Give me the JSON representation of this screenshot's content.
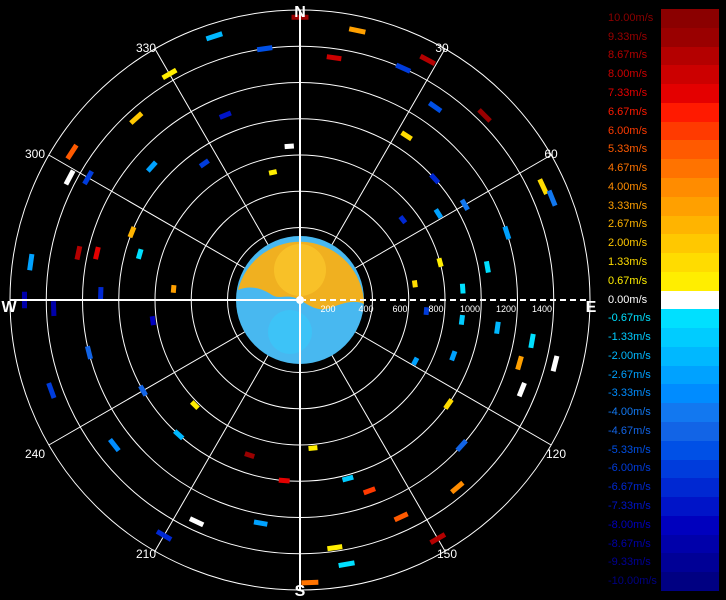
{
  "chart_data": {
    "type": "polar-ppi",
    "directions": {
      "north": "N",
      "east": "E",
      "south": "S",
      "west": "W"
    },
    "azimuth_labels": [
      "30",
      "60",
      "120",
      "150",
      "210",
      "240",
      "300",
      "330"
    ],
    "range_labels": [
      "200",
      "400",
      "600",
      "800",
      "1000",
      "1200",
      "1400"
    ],
    "legend": {
      "levels": [
        {
          "label": "10.00m/s",
          "color": "#8b0000"
        },
        {
          "label": "9.33m/s",
          "color": "#9a0000"
        },
        {
          "label": "8.67m/s",
          "color": "#b40000"
        },
        {
          "label": "8.00m/s",
          "color": "#cc0000"
        },
        {
          "label": "7.33m/s",
          "color": "#e40000"
        },
        {
          "label": "6.67m/s",
          "color": "#ff1a00"
        },
        {
          "label": "6.00m/s",
          "color": "#ff3a00"
        },
        {
          "label": "5.33m/s",
          "color": "#ff5a00"
        },
        {
          "label": "4.67m/s",
          "color": "#ff7300"
        },
        {
          "label": "4.00m/s",
          "color": "#ff8c00"
        },
        {
          "label": "3.33m/s",
          "color": "#ffa000"
        },
        {
          "label": "2.67m/s",
          "color": "#ffb400"
        },
        {
          "label": "2.00m/s",
          "color": "#ffc800"
        },
        {
          "label": "1.33m/s",
          "color": "#ffdc00"
        },
        {
          "label": "0.67m/s",
          "color": "#ffee00"
        },
        {
          "label": "0.00m/s",
          "color": "#ffffff"
        },
        {
          "label": "-0.67m/s",
          "color": "#00e0ff"
        },
        {
          "label": "-1.33m/s",
          "color": "#00ccff"
        },
        {
          "label": "-2.00m/s",
          "color": "#00b8ff"
        },
        {
          "label": "-2.67m/s",
          "color": "#00a2ff"
        },
        {
          "label": "-3.33m/s",
          "color": "#008cff"
        },
        {
          "label": "-4.00m/s",
          "color": "#1278f0"
        },
        {
          "label": "-4.67m/s",
          "color": "#1264e6"
        },
        {
          "label": "-5.33m/s",
          "color": "#0050e6"
        },
        {
          "label": "-6.00m/s",
          "color": "#003cdc"
        },
        {
          "label": "-6.67m/s",
          "color": "#0028d2"
        },
        {
          "label": "-7.33m/s",
          "color": "#0014c8"
        },
        {
          "label": "-8.00m/s",
          "color": "#0000be"
        },
        {
          "label": "-8.67m/s",
          "color": "#0000aa"
        },
        {
          "label": "-9.33m/s",
          "color": "#000096"
        },
        {
          "label": "-10.00m/s",
          "color": "#000082"
        }
      ]
    },
    "range_max": 1600,
    "ring_step": 200,
    "spoke_step_deg": 30,
    "grid": true,
    "legend_position": "right",
    "samples": [
      {
        "az": 0,
        "range": 1560,
        "v": 9.5
      },
      {
        "az": 12,
        "range": 1520,
        "v": 3.0
      },
      {
        "az": 8,
        "range": 1350,
        "v": 8.0
      },
      {
        "az": 28,
        "range": 1500,
        "v": 8.5
      },
      {
        "az": 24,
        "range": 1400,
        "v": -6.0
      },
      {
        "az": 35,
        "range": 1300,
        "v": -5.5
      },
      {
        "az": 33,
        "range": 1080,
        "v": 1.3
      },
      {
        "az": 45,
        "range": 1440,
        "v": 9.0
      },
      {
        "az": 48,
        "range": 1000,
        "v": -7.0
      },
      {
        "az": 58,
        "range": 900,
        "v": -3.0
      },
      {
        "az": 60,
        "range": 1050,
        "v": -4.0
      },
      {
        "az": 52,
        "range": 720,
        "v": -6.5
      },
      {
        "az": 65,
        "range": 1480,
        "v": 1.3
      },
      {
        "az": 68,
        "range": 1500,
        "v": -4.0
      },
      {
        "az": 72,
        "range": 1200,
        "v": -2.5
      },
      {
        "az": 75,
        "range": 800,
        "v": 0.6
      },
      {
        "az": 80,
        "range": 1050,
        "v": -1.0
      },
      {
        "az": 82,
        "range": 640,
        "v": 1.3
      },
      {
        "az": 86,
        "range": 900,
        "v": -0.7
      },
      {
        "az": 95,
        "range": 700,
        "v": -6.0
      },
      {
        "az": 97,
        "range": 900,
        "v": -1.3
      },
      {
        "az": 98,
        "range": 1100,
        "v": -2.0
      },
      {
        "az": 100,
        "range": 1300,
        "v": -0.7
      },
      {
        "az": 104,
        "range": 1450,
        "v": 0.0
      },
      {
        "az": 106,
        "range": 1260,
        "v": 3.3
      },
      {
        "az": 110,
        "range": 900,
        "v": -2.5
      },
      {
        "az": 112,
        "range": 1320,
        "v": 0.0
      },
      {
        "az": 118,
        "range": 720,
        "v": -3.0
      },
      {
        "az": 125,
        "range": 1000,
        "v": 1.3
      },
      {
        "az": 132,
        "range": 1200,
        "v": -4.5
      },
      {
        "az": 140,
        "range": 1350,
        "v": 4.0
      },
      {
        "az": 150,
        "range": 1520,
        "v": 8.5
      },
      {
        "az": 155,
        "range": 1320,
        "v": 5.0
      },
      {
        "az": 160,
        "range": 1120,
        "v": 6.0
      },
      {
        "az": 165,
        "range": 1020,
        "v": -1.3
      },
      {
        "az": 170,
        "range": 1480,
        "v": -0.7
      },
      {
        "az": 172,
        "range": 1380,
        "v": 1.0
      },
      {
        "az": 175,
        "range": 820,
        "v": 0.5
      },
      {
        "az": 178,
        "range": 1560,
        "v": 4.5
      },
      {
        "az": 185,
        "range": 1000,
        "v": 7.5
      },
      {
        "az": 190,
        "range": 1250,
        "v": -3.0
      },
      {
        "az": 198,
        "range": 900,
        "v": 9.0
      },
      {
        "az": 205,
        "range": 1350,
        "v": 0.0
      },
      {
        "az": 210,
        "range": 1500,
        "v": -7.0
      },
      {
        "az": 222,
        "range": 1000,
        "v": -2.0
      },
      {
        "az": 225,
        "range": 820,
        "v": 0.5
      },
      {
        "az": 232,
        "range": 1300,
        "v": -3.5
      },
      {
        "az": 240,
        "range": 1000,
        "v": -5.0
      },
      {
        "az": 250,
        "range": 1460,
        "v": -6.0
      },
      {
        "az": 256,
        "range": 1200,
        "v": -4.5
      },
      {
        "az": 262,
        "range": 820,
        "v": -8.0
      },
      {
        "az": 268,
        "range": 1360,
        "v": -8.5
      },
      {
        "az": 270,
        "range": 1520,
        "v": -9.0
      },
      {
        "az": 272,
        "range": 1100,
        "v": -6.5
      },
      {
        "az": 275,
        "range": 700,
        "v": 3.0
      },
      {
        "az": 278,
        "range": 1500,
        "v": -2.5
      },
      {
        "az": 282,
        "range": 1250,
        "v": 8.5
      },
      {
        "az": 283,
        "range": 1150,
        "v": 7.0
      },
      {
        "az": 286,
        "range": 920,
        "v": -0.7
      },
      {
        "az": 292,
        "range": 1000,
        "v": 2.5
      },
      {
        "az": 298,
        "range": 1440,
        "v": 0.0
      },
      {
        "az": 300,
        "range": 1350,
        "v": -6.0
      },
      {
        "az": 303,
        "range": 1500,
        "v": 5.0
      },
      {
        "az": 312,
        "range": 1100,
        "v": -3.0
      },
      {
        "az": 318,
        "range": 1350,
        "v": 2.3
      },
      {
        "az": 325,
        "range": 920,
        "v": -6.0
      },
      {
        "az": 330,
        "range": 1440,
        "v": 0.5
      },
      {
        "az": 338,
        "range": 1100,
        "v": -7.5
      },
      {
        "az": 342,
        "range": 1530,
        "v": -2.0
      },
      {
        "az": 348,
        "range": 720,
        "v": 1.0
      },
      {
        "az": 352,
        "range": 1400,
        "v": -5.5
      },
      {
        "az": 356,
        "range": 850,
        "v": 0.0
      }
    ]
  }
}
